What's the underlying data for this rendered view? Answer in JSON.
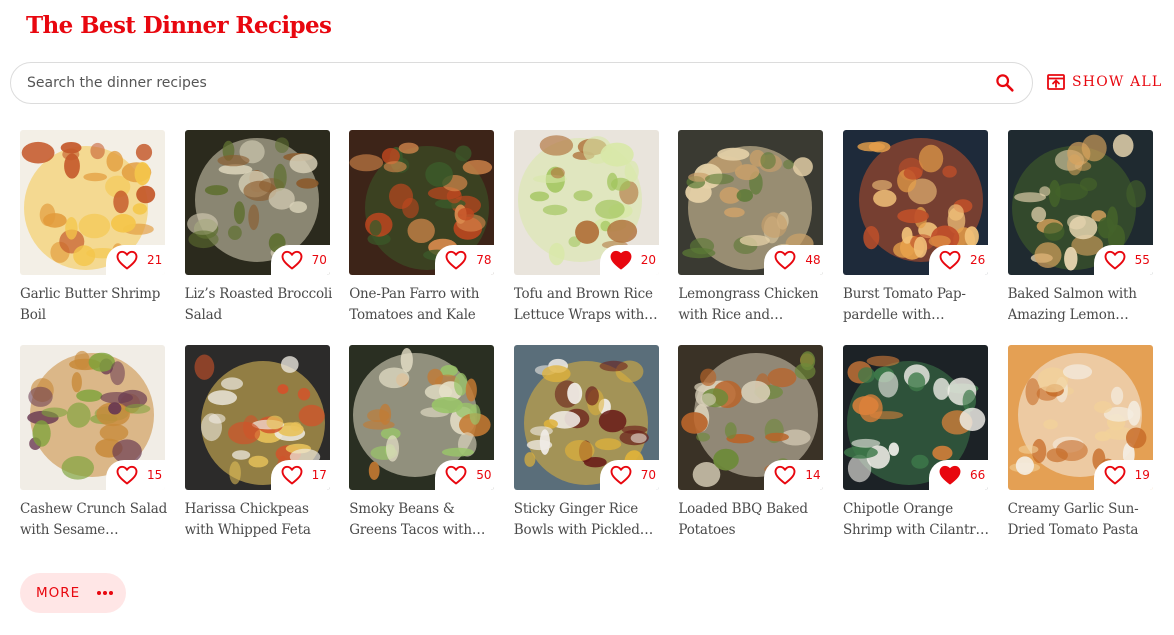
{
  "page": {
    "title": "The Best Dinner Recipes",
    "accent_color": "#e8070f",
    "more_bg_color": "#ffe6e6"
  },
  "search": {
    "placeholder": "Search the dinner recipes",
    "icon": "search-icon"
  },
  "show_all": {
    "label": "SHOW ALL",
    "icon": "open-in-new-icon"
  },
  "recipes": [
    {
      "title": "Garlic Butter Shrimp Boil",
      "likes": "21",
      "liked": false,
      "image": "shrimp-boil-photo",
      "colors": [
        "#f3efe6",
        "#e29a3a",
        "#c4582a",
        "#f4c64a"
      ]
    },
    {
      "title": "Liz’s Roasted Broccoli Salad",
      "likes": "70",
      "liked": false,
      "image": "broccoli-salad-photo",
      "colors": [
        "#2b2a1d",
        "#5f7031",
        "#8b5a2b",
        "#d8d1b8"
      ]
    },
    {
      "title": "One-Pan Farro with Tomatoes and Kale",
      "likes": "78",
      "liked": false,
      "image": "farro-photo",
      "colors": [
        "#3d2418",
        "#c2471f",
        "#d98a4d",
        "#3b5a2a"
      ]
    },
    {
      "title": "Tofu and Brown Rice Lettuce Wraps with…",
      "likes": "20",
      "liked": true,
      "image": "lettuce-wraps-photo",
      "colors": [
        "#e9e4dc",
        "#9fc45a",
        "#b0723c",
        "#d8e8a8"
      ]
    },
    {
      "title": "Lemongrass Chicken with Rice and…",
      "likes": "48",
      "liked": false,
      "image": "lemongrass-chicken-photo",
      "colors": [
        "#3a3a32",
        "#c9a06a",
        "#5c7a36",
        "#e6d2a8"
      ]
    },
    {
      "title": "Burst Tomato Pap-pardelle with Zucchi…",
      "likes": "26",
      "liked": false,
      "image": "pappardelle-photo",
      "colors": [
        "#1e2a3a",
        "#e6a04a",
        "#f2c27a",
        "#c0502a"
      ]
    },
    {
      "title": "Baked Salmon with Amazing Lemon…",
      "likes": "55",
      "liked": false,
      "image": "baked-salmon-photo",
      "colors": [
        "#1f2a30",
        "#d9a45e",
        "#e8d6b0",
        "#44622a"
      ]
    },
    {
      "title": "Cashew Crunch Salad with Sesame Dressing",
      "likes": "15",
      "liked": false,
      "image": "cashew-salad-photo",
      "colors": [
        "#f1ede6",
        "#6a3a52",
        "#7ea43c",
        "#c88a3a"
      ]
    },
    {
      "title": "Harissa Chickpeas with Whipped Feta",
      "likes": "17",
      "liked": false,
      "image": "harissa-chickpeas-photo",
      "colors": [
        "#2c2b2a",
        "#d2532a",
        "#f0ece4",
        "#e8c25a"
      ]
    },
    {
      "title": "Smoky Beans & Greens Tacos with Aj…",
      "likes": "50",
      "liked": false,
      "image": "tacos-photo",
      "colors": [
        "#2a2f22",
        "#9ac46a",
        "#c47a32",
        "#e6e0c8"
      ]
    },
    {
      "title": "Sticky Ginger Rice Bowls with Pickled…",
      "likes": "70",
      "liked": false,
      "image": "rice-bowl-photo",
      "colors": [
        "#5a6e7a",
        "#6a1e1a",
        "#f0ece6",
        "#e0b23a"
      ]
    },
    {
      "title": "Loaded BBQ Baked Potatoes",
      "likes": "14",
      "liked": false,
      "image": "bbq-potatoes-photo",
      "colors": [
        "#3a3226",
        "#b8642a",
        "#6e8a3a",
        "#d8cfb8"
      ]
    },
    {
      "title": "Chipotle Orange Shrimp with Cilantr…",
      "likes": "66",
      "liked": true,
      "image": "chipotle-shrimp-photo",
      "colors": [
        "#1c2226",
        "#e0823a",
        "#f0eee8",
        "#3e7a4a"
      ]
    },
    {
      "title": "Creamy Garlic Sun-Dried Tomato Pasta",
      "likes": "19",
      "liked": false,
      "image": "creamy-pasta-photo",
      "colors": [
        "#e4a054",
        "#c66a26",
        "#f2d29a",
        "#f4ede2"
      ]
    }
  ],
  "more": {
    "label": "MORE",
    "icon": "more-dots-icon"
  }
}
